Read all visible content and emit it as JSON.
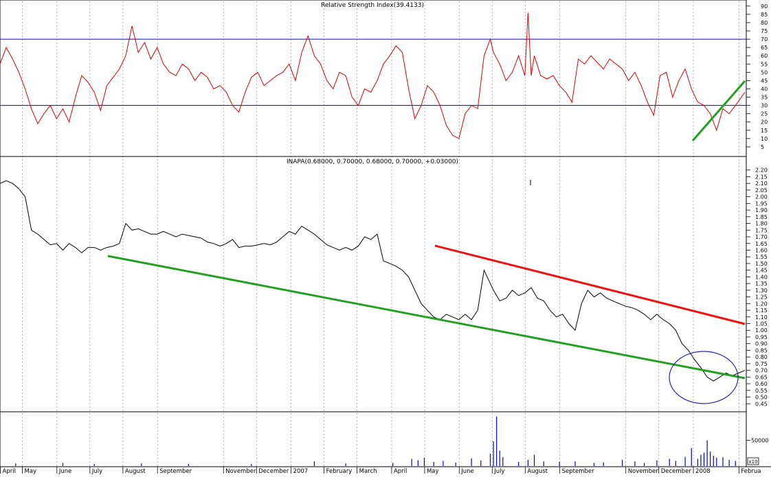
{
  "colors": {
    "rsi_line": "#dd0000",
    "rsi_bands": "#0000dd",
    "price": "#000000",
    "volume": "#0000cc",
    "trend_support": "#22a022",
    "trend_resistance": "#ee1111",
    "highlight_circle": "#2222cc",
    "grid": "#999999"
  },
  "months": [
    {
      "label": "April",
      "x": 0
    },
    {
      "label": "May",
      "x": 14
    },
    {
      "label": "June",
      "x": 36
    },
    {
      "label": "July",
      "x": 57
    },
    {
      "label": "August",
      "x": 78
    },
    {
      "label": "September",
      "x": 100
    },
    {
      "label": "November",
      "x": 142
    },
    {
      "label": "December",
      "x": 163
    },
    {
      "label": "2007",
      "x": 185
    },
    {
      "label": "February",
      "x": 206
    },
    {
      "label": "March",
      "x": 227
    },
    {
      "label": "April",
      "x": 249
    },
    {
      "label": "May",
      "x": 270
    },
    {
      "label": "June",
      "x": 292
    },
    {
      "label": "July",
      "x": 313
    },
    {
      "label": "August",
      "x": 334
    },
    {
      "label": "September",
      "x": 356
    },
    {
      "label": "November",
      "x": 398
    },
    {
      "label": "December",
      "x": 419
    },
    {
      "label": "2008",
      "x": 441
    },
    {
      "label": "Februa",
      "x": 470
    }
  ],
  "chart_data": [
    {
      "type": "line",
      "title": "Relative Strength Index(39.4133)",
      "ylim": [
        0,
        92
      ],
      "y_ticks": [
        5,
        10,
        15,
        20,
        25,
        30,
        35,
        40,
        45,
        50,
        55,
        60,
        65,
        70,
        75,
        80,
        85,
        90
      ],
      "reference_lines": [
        30,
        70
      ],
      "series": [
        {
          "x": [
            0,
            4,
            8,
            12,
            16,
            20,
            24,
            28,
            32,
            36,
            40,
            44,
            48,
            52,
            56,
            60,
            64,
            68,
            72,
            76,
            80,
            84,
            88,
            92,
            96,
            100,
            104,
            108,
            112,
            116,
            120,
            124,
            128,
            132,
            136,
            140,
            144,
            148,
            152,
            156,
            160,
            164,
            168,
            172,
            176,
            180,
            184,
            188,
            192,
            196,
            200,
            204,
            208,
            212,
            216,
            220,
            224,
            228,
            232,
            236,
            240,
            244,
            248,
            252,
            256,
            260,
            264,
            268,
            272,
            276,
            280,
            284,
            288,
            292,
            296,
            300,
            304,
            308,
            312,
            314,
            318,
            322,
            326,
            330,
            334,
            336,
            338,
            340,
            344,
            348,
            352,
            356,
            360,
            364,
            368,
            372,
            376,
            380,
            384,
            388,
            392,
            396,
            400,
            404,
            408,
            412,
            416,
            420,
            424,
            428,
            432,
            436,
            440,
            444,
            448,
            452,
            456,
            460,
            464,
            468,
            474
          ],
          "values": [
            55,
            65,
            58,
            50,
            40,
            28,
            19,
            25,
            30,
            22,
            28,
            20,
            35,
            48,
            44,
            38,
            27,
            42,
            47,
            52,
            60,
            78,
            62,
            68,
            58,
            65,
            55,
            50,
            48,
            55,
            52,
            45,
            50,
            47,
            40,
            42,
            38,
            30,
            26,
            38,
            47,
            50,
            42,
            45,
            48,
            50,
            55,
            45,
            62,
            72,
            60,
            55,
            45,
            40,
            50,
            48,
            35,
            30,
            40,
            38,
            45,
            55,
            60,
            66,
            62,
            40,
            22,
            30,
            42,
            38,
            30,
            18,
            12,
            10,
            25,
            30,
            28,
            60,
            70,
            62,
            55,
            45,
            50,
            60,
            48,
            86,
            48,
            60,
            48,
            46,
            48,
            42,
            38,
            32,
            58,
            55,
            60,
            56,
            52,
            58,
            55,
            52,
            45,
            50,
            42,
            32,
            24,
            48,
            50,
            35,
            45,
            52,
            40,
            32,
            30,
            25,
            15,
            28,
            25,
            30,
            38
          ]
        }
      ]
    },
    {
      "type": "line",
      "title": "INAPA(0.68000, 0.70000, 0.68000, 0.70000, +0.03000)",
      "ylim": [
        0.4,
        2.25
      ],
      "y_ticks": [
        0.45,
        0.5,
        0.55,
        0.6,
        0.65,
        0.7,
        0.75,
        0.8,
        0.85,
        0.9,
        0.95,
        1.0,
        1.05,
        1.1,
        1.15,
        1.2,
        1.25,
        1.3,
        1.35,
        1.4,
        1.45,
        1.5,
        1.55,
        1.6,
        1.65,
        1.7,
        1.75,
        1.8,
        1.85,
        1.9,
        1.95,
        2.0,
        2.05,
        2.1,
        2.15,
        2.2
      ],
      "series": [
        {
          "x": [
            0,
            4,
            8,
            12,
            16,
            20,
            24,
            28,
            32,
            36,
            40,
            44,
            48,
            52,
            56,
            60,
            64,
            68,
            72,
            76,
            80,
            84,
            88,
            92,
            96,
            100,
            104,
            108,
            112,
            116,
            120,
            124,
            128,
            132,
            136,
            140,
            144,
            148,
            152,
            156,
            160,
            164,
            168,
            172,
            176,
            180,
            184,
            188,
            192,
            196,
            200,
            204,
            208,
            212,
            216,
            220,
            224,
            228,
            232,
            236,
            240,
            244,
            248,
            252,
            256,
            260,
            264,
            268,
            272,
            276,
            280,
            284,
            288,
            292,
            296,
            300,
            304,
            308,
            312,
            314,
            318,
            322,
            326,
            330,
            334,
            338,
            342,
            346,
            350,
            354,
            358,
            362,
            366,
            370,
            374,
            378,
            382,
            386,
            390,
            394,
            398,
            402,
            406,
            410,
            414,
            418,
            422,
            426,
            430,
            434,
            438,
            442,
            446,
            450,
            454,
            458,
            462,
            466,
            470,
            474
          ],
          "values": [
            2.1,
            2.12,
            2.1,
            2.06,
            2.0,
            1.75,
            1.72,
            1.68,
            1.64,
            1.65,
            1.6,
            1.65,
            1.62,
            1.58,
            1.62,
            1.62,
            1.6,
            1.62,
            1.63,
            1.65,
            1.8,
            1.75,
            1.76,
            1.74,
            1.72,
            1.72,
            1.74,
            1.72,
            1.7,
            1.72,
            1.71,
            1.7,
            1.69,
            1.66,
            1.65,
            1.63,
            1.65,
            1.68,
            1.62,
            1.63,
            1.63,
            1.64,
            1.65,
            1.64,
            1.66,
            1.7,
            1.74,
            1.72,
            1.78,
            1.75,
            1.72,
            1.68,
            1.64,
            1.62,
            1.6,
            1.62,
            1.6,
            1.63,
            1.7,
            1.68,
            1.72,
            1.52,
            1.5,
            1.48,
            1.45,
            1.4,
            1.3,
            1.2,
            1.15,
            1.1,
            1.08,
            1.12,
            1.1,
            1.08,
            1.12,
            1.08,
            1.15,
            1.45,
            1.35,
            1.3,
            1.22,
            1.24,
            1.3,
            1.26,
            1.28,
            1.32,
            1.24,
            1.22,
            1.15,
            1.1,
            1.12,
            1.05,
            1.0,
            1.2,
            1.3,
            1.25,
            1.28,
            1.24,
            1.22,
            1.2,
            1.18,
            1.17,
            1.15,
            1.12,
            1.08,
            1.12,
            1.08,
            1.05,
            1.0,
            0.9,
            0.85,
            0.78,
            0.72,
            0.65,
            0.62,
            0.65,
            0.68,
            0.66,
            0.68,
            0.7
          ]
        }
      ],
      "annotations": [
        "support trendline",
        "resistance trendline",
        "highlight circle"
      ]
    },
    {
      "type": "bar",
      "y_ticks": [
        50000
      ],
      "y_tick_labels": [
        "50000"
      ],
      "corner_label": "x10",
      "series": [
        {
          "x": [
            10,
            40,
            60,
            90,
            120,
            160,
            200,
            220,
            250,
            262,
            266,
            270,
            276,
            282,
            290,
            300,
            306,
            312,
            314,
            316,
            318,
            320,
            330,
            336,
            340,
            346,
            356,
            366,
            378,
            384,
            396,
            404,
            410,
            418,
            426,
            430,
            436,
            440,
            444,
            446,
            448,
            450,
            452,
            454,
            456,
            460,
            464,
            468
          ],
          "values": [
            5000,
            6000,
            4000,
            5000,
            4000,
            4000,
            9000,
            5000,
            6000,
            14000,
            11000,
            16000,
            8000,
            10000,
            7000,
            15000,
            11000,
            24000,
            48000,
            96000,
            30000,
            17000,
            8000,
            12000,
            22000,
            9000,
            8000,
            9000,
            6000,
            7000,
            12000,
            9000,
            6000,
            11000,
            14000,
            10000,
            18000,
            35000,
            14000,
            22000,
            26000,
            50000,
            28000,
            20000,
            16000,
            17000,
            12000,
            10000
          ]
        }
      ]
    }
  ]
}
